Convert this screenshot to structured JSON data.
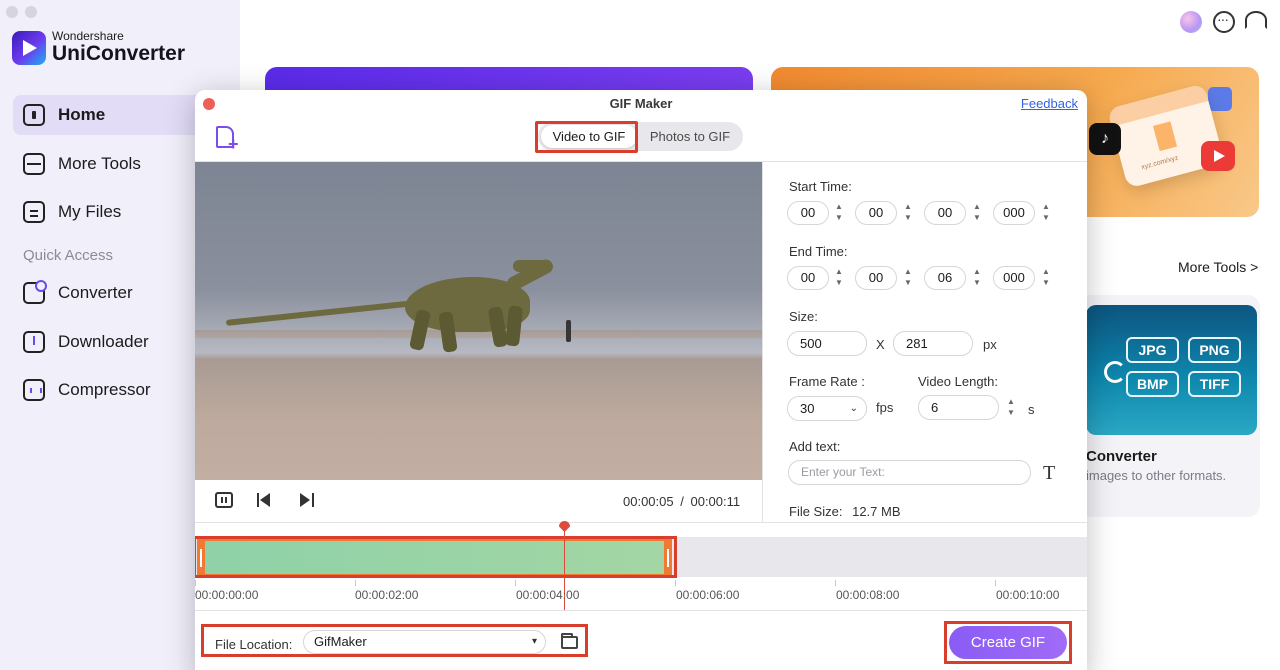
{
  "app": {
    "brand_small": "Wondershare",
    "brand_name": "UniConverter"
  },
  "sidebar": {
    "items": [
      {
        "label": "Home",
        "icon": "home-icon",
        "active": true
      },
      {
        "label": "More Tools",
        "icon": "toolbox-icon"
      },
      {
        "label": "My Files",
        "icon": "files-icon"
      }
    ],
    "quick_access_label": "Quick Access",
    "quick_items": [
      {
        "label": "Converter",
        "icon": "converter-icon"
      },
      {
        "label": "Downloader",
        "icon": "downloader-icon"
      },
      {
        "label": "Compressor",
        "icon": "compressor-icon"
      }
    ]
  },
  "top_icons": [
    "avatar",
    "chat-icon",
    "headset-icon"
  ],
  "home": {
    "more_tools_link": "More Tools >",
    "downloader_card_url": "xyz.com/xyz",
    "converter_card": {
      "title": "Converter",
      "description": "images to other formats.",
      "formats": [
        "JPG",
        "PNG",
        "BMP",
        "TIFF"
      ]
    }
  },
  "gif_maker": {
    "title": "GIF Maker",
    "feedback": "Feedback",
    "tabs": [
      {
        "label": "Video to GIF",
        "active": true
      },
      {
        "label": "Photos to GIF",
        "active": false
      }
    ],
    "player": {
      "current_time": "00:00:05",
      "separator": "/",
      "total_time": "00:00:11"
    },
    "settings": {
      "start_label": "Start Time:",
      "start": [
        "00",
        "00",
        "00",
        "000"
      ],
      "end_label": "End Time:",
      "end": [
        "00",
        "00",
        "06",
        "000"
      ],
      "size_label": "Size:",
      "width": "500",
      "size_x": "X",
      "height": "281",
      "size_unit": "px",
      "frame_rate_label": "Frame Rate :",
      "frame_rate": "30",
      "fps_unit": "fps",
      "video_length_label": "Video Length:",
      "video_length": "6",
      "length_unit": "s",
      "add_text_label": "Add text:",
      "text_placeholder": "Enter your Text:",
      "file_size_label": "File Size:",
      "file_size": "12.7 MB"
    },
    "timeline": {
      "ticks": [
        "00:00:00:00",
        "00:00:02:00",
        "00:00:04:00",
        "00:00:06:00",
        "00:00:08:00",
        "00:00:10:00"
      ],
      "selection_start_s": 0,
      "selection_end_s": 6,
      "playhead_s": 4.6
    },
    "bottom": {
      "file_location_label": "File Location:",
      "file_location_value": "GifMaker",
      "create_button": "Create GIF"
    }
  },
  "colors": {
    "accent": "#8a5cf5",
    "highlight_frame": "#d93d2c",
    "trim_handle": "#f07a34",
    "link": "#3363e0"
  }
}
